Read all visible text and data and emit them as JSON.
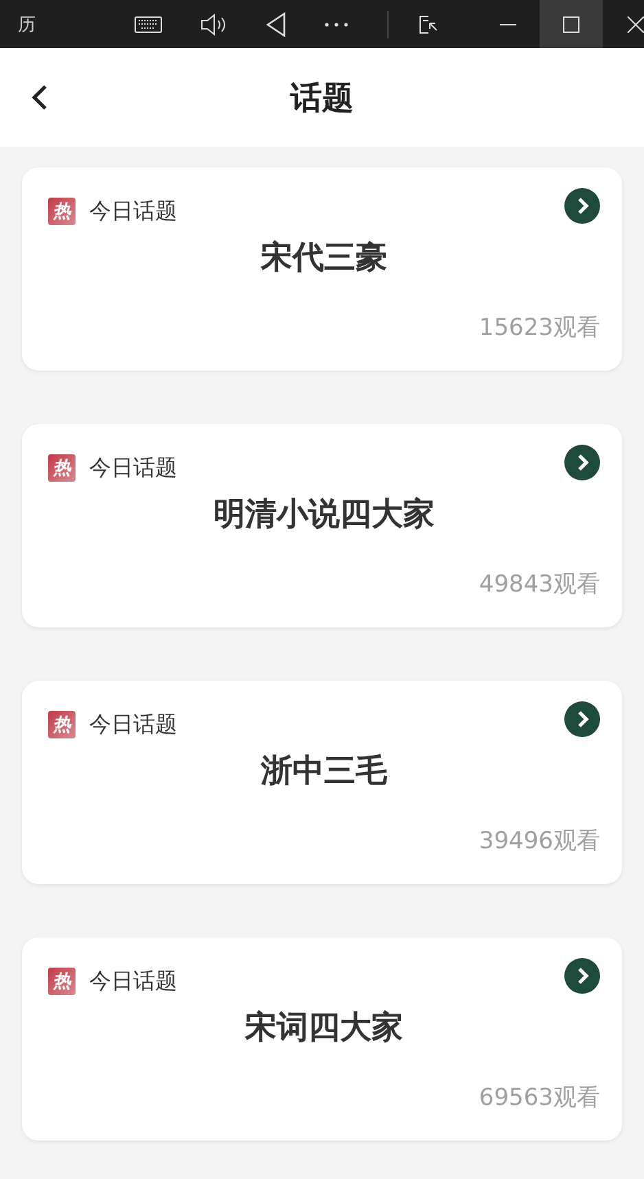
{
  "window": {
    "title": "历"
  },
  "header": {
    "title": "话题"
  },
  "topics": [
    {
      "badge": "热",
      "label": "今日话题",
      "title": "宋代三豪",
      "views": "15623观看"
    },
    {
      "badge": "热",
      "label": "今日话题",
      "title": "明清小说四大家",
      "views": "49843观看"
    },
    {
      "badge": "热",
      "label": "今日话题",
      "title": "浙中三毛",
      "views": "39496观看"
    },
    {
      "badge": "热",
      "label": "今日话题",
      "title": "宋词四大家",
      "views": "69563观看"
    }
  ]
}
